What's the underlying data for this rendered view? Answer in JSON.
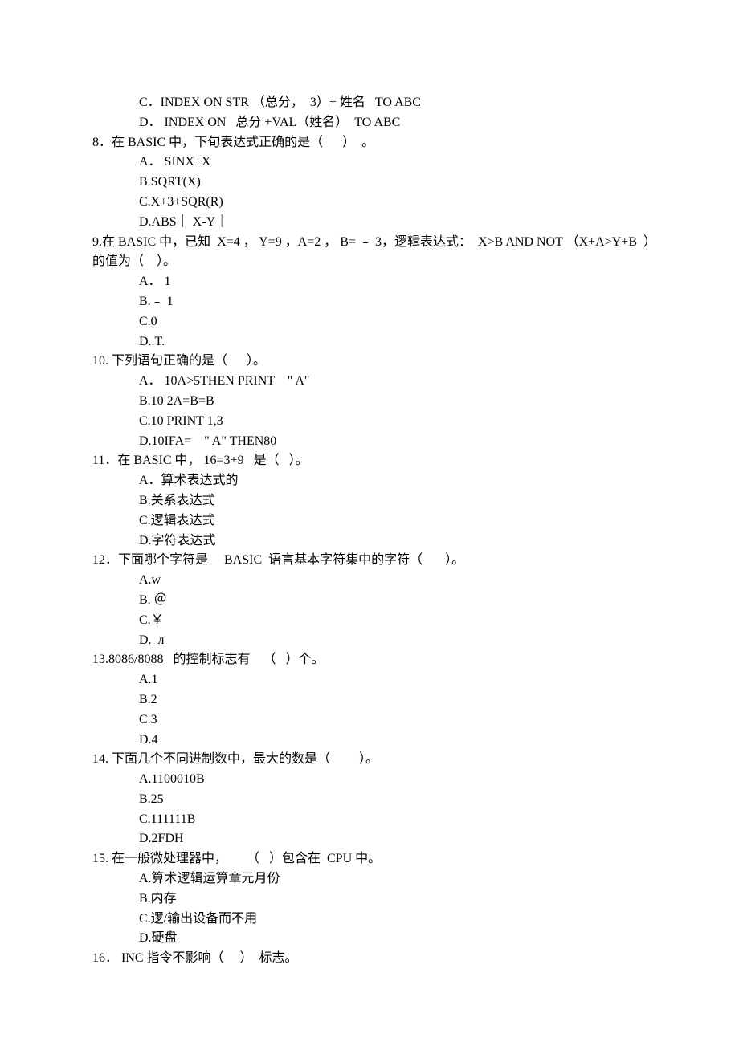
{
  "prevOptions": {
    "c": "C．INDEX ON STR （总分，  3）+ 姓名   TO ABC",
    "d": "D． INDEX ON   总分 +VAL（姓名）  TO ABC"
  },
  "q8": {
    "stem": "8．在 BASIC 中，下旬表达式正确的是（      ）  。",
    "a": "A． SINX+X",
    "b": "B.SQRT(X)",
    "c": "C.X+3+SQR(R)",
    "d": "D.ABS｜ X-Y｜"
  },
  "q9": {
    "stem1": "9.在 BASIC 中，已知  X=4 ， Y=9 ，A=2 ， B= ﹣ 3，逻辑表达式：  X>B AND NOT （X+A>Y+B  ）",
    "stem2": "的值为（    ）。",
    "a": "A． 1",
    "b": "B.﹣ 1",
    "c": "C.0",
    "d": "D..T."
  },
  "q10": {
    "stem": "10. 下列语句正确的是（      ）。",
    "a": "A． 10A>5THEN PRINT    \" A\"",
    "b": "B.10 2A=B=B",
    "c": "C.10 PRINT 1,3",
    "d": "D.10IFA=    \" A\" THEN80"
  },
  "q11": {
    "stem": "11．在 BASIC 中， 16=3+9   是（   ）。",
    "a": "A．算术表达式的",
    "b": "B.关系表达式",
    "c": "C.逻辑表达式",
    "d": "D.字符表达式"
  },
  "q12": {
    "stem": "12．下面哪个字符是     BASIC  语言基本字符集中的字符（       ）。",
    "a": "A.w",
    "b": "B. ＠",
    "c": "C.￥",
    "d": "D.  л"
  },
  "q13": {
    "stem": "13.8086/8088   的控制标志有    （   ）个。",
    "a": "A.1",
    "b": "B.2",
    "c": "C.3",
    "d": "D.4"
  },
  "q14": {
    "stem": "14. 下面几个不同进制数中，最大的数是（         ）。",
    "a": "A.1100010B",
    "b": "B.25",
    "c": "C.111111B",
    "d": "D.2FDH"
  },
  "q15": {
    "stem": "15. 在一般微处理器中，      （   ）包含在  CPU 中。",
    "a": "A.算术逻辑运算章元月份",
    "b": "B.内存",
    "c": "C.逻/输出设备而不用",
    "d": "D.硬盘"
  },
  "q16": {
    "stem": "16． INC 指令不影响（     ）  标志。"
  }
}
